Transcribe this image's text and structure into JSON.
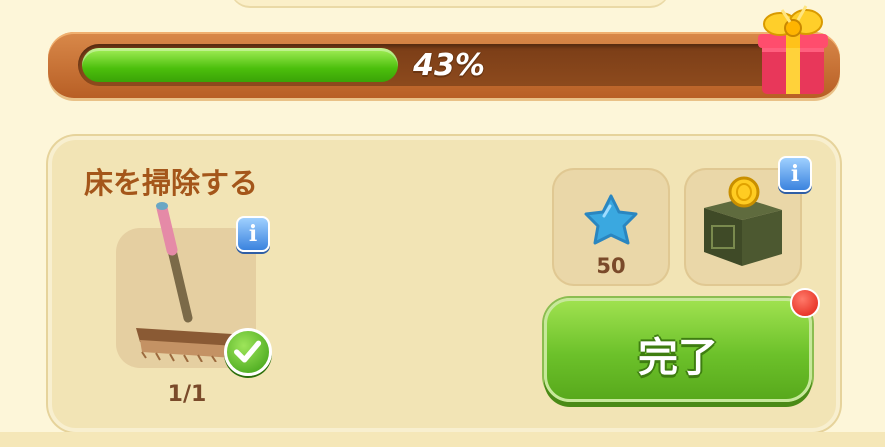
{
  "progress": {
    "percent": 43,
    "label": "43%",
    "reward_icon": "gift-box-icon"
  },
  "task": {
    "title": "床を掃除する",
    "item_icon": "broom-icon",
    "count": "1/1",
    "completed": true
  },
  "rewards": [
    {
      "icon": "blue-star-icon",
      "value": "50"
    },
    {
      "icon": "coin-safe-box-icon",
      "value": ""
    }
  ],
  "actions": {
    "complete_label": "完了",
    "has_notification": true
  },
  "colors": {
    "progress_green": "#4cbf0c",
    "title_brown": "#a4561a",
    "button_green": "#6cc12a",
    "info_blue": "#3b83de",
    "alert_red": "#e01e12"
  }
}
